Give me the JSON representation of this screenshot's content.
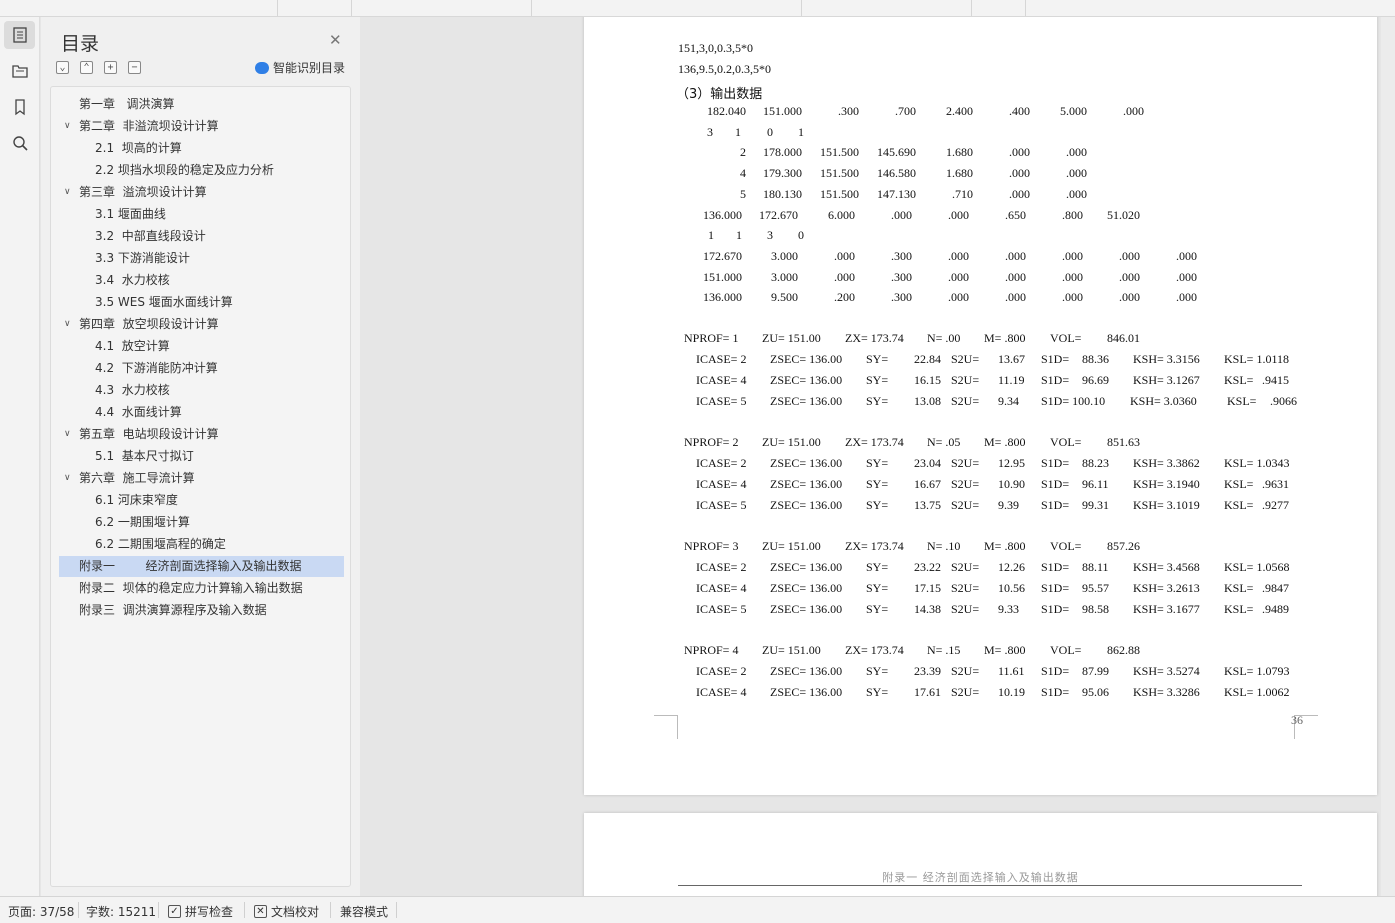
{
  "toc": {
    "title": "目录",
    "smart_label": "智能识别目录",
    "items": [
      {
        "label": "第一章   调洪演算",
        "level": 1,
        "expandable": false
      },
      {
        "label": "第二章  非溢流坝设计计算",
        "level": 1,
        "expandable": true
      },
      {
        "label": "2.1  坝高的计算",
        "level": 2,
        "expandable": false
      },
      {
        "label": "2.2 坝挡水坝段的稳定及应力分析",
        "level": 2,
        "expandable": false
      },
      {
        "label": "第三章  溢流坝设计计算",
        "level": 1,
        "expandable": true
      },
      {
        "label": "3.1 堰面曲线",
        "level": 2,
        "expandable": false
      },
      {
        "label": "3.2  中部直线段设计",
        "level": 2,
        "expandable": false
      },
      {
        "label": "3.3 下游消能设计",
        "level": 2,
        "expandable": false
      },
      {
        "label": "3.4  水力校核",
        "level": 2,
        "expandable": false
      },
      {
        "label": "3.5 WES 堰面水面线计算",
        "level": 2,
        "expandable": false
      },
      {
        "label": "第四章  放空坝段设计计算",
        "level": 1,
        "expandable": true
      },
      {
        "label": "4.1  放空计算",
        "level": 2,
        "expandable": false
      },
      {
        "label": "4.2  下游消能防冲计算",
        "level": 2,
        "expandable": false
      },
      {
        "label": "4.3  水力校核",
        "level": 2,
        "expandable": false
      },
      {
        "label": "4.4  水面线计算",
        "level": 2,
        "expandable": false
      },
      {
        "label": "第五章  电站坝段设计计算",
        "level": 1,
        "expandable": true
      },
      {
        "label": "5.1  基本尺寸拟订",
        "level": 2,
        "expandable": false
      },
      {
        "label": "第六章  施工导流计算",
        "level": 1,
        "expandable": true
      },
      {
        "label": "6.1 河床束窄度",
        "level": 2,
        "expandable": false
      },
      {
        "label": "6.2 一期围堰计算",
        "level": 2,
        "expandable": false
      },
      {
        "label": "6.2 二期围堰高程的确定",
        "level": 2,
        "expandable": false
      },
      {
        "label": "附录一        经济剖面选择输入及输出数据",
        "level": 1,
        "expandable": false,
        "selected": true
      },
      {
        "label": "附录二  坝体的稳定应力计算输入输出数据",
        "level": 1,
        "expandable": false
      },
      {
        "label": "附录三  调洪演算源程序及输入数据",
        "level": 1,
        "expandable": false
      }
    ]
  },
  "document": {
    "page1": {
      "input_lines": [
        "151,3,0,0.3,5*0",
        "136,9.5,0.2,0.3,5*0"
      ],
      "section_heading": "（3）输出数据",
      "rows_a": [
        [
          "182.040",
          "151.000",
          ".300",
          ".700",
          "2.400",
          ".400",
          "5.000",
          ".000"
        ],
        [
          "3",
          "1",
          "0",
          "1"
        ],
        [
          "2",
          "178.000",
          "151.500",
          "145.690",
          "1.680",
          ".000",
          ".000"
        ],
        [
          "4",
          "179.300",
          "151.500",
          "146.580",
          "1.680",
          ".000",
          ".000"
        ],
        [
          "5",
          "180.130",
          "151.500",
          "147.130",
          ".710",
          ".000",
          ".000"
        ],
        [
          "136.000",
          "172.670",
          "6.000",
          ".000",
          ".000",
          ".650",
          ".800",
          "51.020"
        ],
        [
          "1",
          "1",
          "3",
          "0"
        ],
        [
          "172.670",
          "3.000",
          ".000",
          ".300",
          ".000",
          ".000",
          ".000",
          ".000",
          ".000"
        ],
        [
          "151.000",
          "3.000",
          ".000",
          ".300",
          ".000",
          ".000",
          ".000",
          ".000",
          ".000"
        ],
        [
          "136.000",
          "9.500",
          ".200",
          ".300",
          ".000",
          ".000",
          ".000",
          ".000",
          ".000"
        ]
      ],
      "profiles": [
        {
          "header": [
            "NPROF= 1",
            "ZU= 151.00",
            "ZX= 173.74",
            "N= .00",
            "M= .800",
            "VOL=",
            "846.01"
          ],
          "cases": [
            [
              "ICASE= 2",
              "ZSEC= 136.00",
              "SY=",
              "22.84",
              "S2U=",
              "13.67",
              "S1D=",
              "88.36",
              "KSH= 3.3156",
              "KSL= 1.0118"
            ],
            [
              "ICASE= 4",
              "ZSEC= 136.00",
              "SY=",
              "16.15",
              "S2U=",
              "11.19",
              "S1D=",
              "96.69",
              "KSH= 3.1267",
              "KSL=",
              ".9415"
            ],
            [
              "ICASE= 5",
              "ZSEC= 136.00",
              "SY=",
              "13.08",
              "S2U=",
              "9.34",
              "S1D= 100.10",
              "",
              "KSH= 3.0360",
              "KSL=",
              ".9066"
            ]
          ]
        },
        {
          "header": [
            "NPROF= 2",
            "ZU= 151.00",
            "ZX= 173.74",
            "N= .05",
            "M= .800",
            "VOL=",
            "851.63"
          ],
          "cases": [
            [
              "ICASE= 2",
              "ZSEC= 136.00",
              "SY=",
              "23.04",
              "S2U=",
              "12.95",
              "S1D=",
              "88.23",
              "KSH= 3.3862",
              "KSL= 1.0343"
            ],
            [
              "ICASE= 4",
              "ZSEC= 136.00",
              "SY=",
              "16.67",
              "S2U=",
              "10.90",
              "S1D=",
              "96.11",
              "KSH= 3.1940",
              "KSL=",
              ".9631"
            ],
            [
              "ICASE= 5",
              "ZSEC= 136.00",
              "SY=",
              "13.75",
              "S2U=",
              "9.39",
              "S1D=",
              "99.31",
              "KSH= 3.1019",
              "KSL=",
              ".9277"
            ]
          ]
        },
        {
          "header": [
            "NPROF= 3",
            "ZU= 151.00",
            "ZX= 173.74",
            "N= .10",
            "M= .800",
            "VOL=",
            "857.26"
          ],
          "cases": [
            [
              "ICASE= 2",
              "ZSEC= 136.00",
              "SY=",
              "23.22",
              "S2U=",
              "12.26",
              "S1D=",
              "88.11",
              "KSH= 3.4568",
              "KSL= 1.0568"
            ],
            [
              "ICASE= 4",
              "ZSEC= 136.00",
              "SY=",
              "17.15",
              "S2U=",
              "10.56",
              "S1D=",
              "95.57",
              "KSH= 3.2613",
              "KSL=",
              ".9847"
            ],
            [
              "ICASE= 5",
              "ZSEC= 136.00",
              "SY=",
              "14.38",
              "S2U=",
              "9.33",
              "S1D=",
              "98.58",
              "KSH= 3.1677",
              "KSL=",
              ".9489"
            ]
          ]
        },
        {
          "header": [
            "NPROF= 4",
            "ZU= 151.00",
            "ZX= 173.74",
            "N= .15",
            "M= .800",
            "VOL=",
            "862.88"
          ],
          "cases": [
            [
              "ICASE= 2",
              "ZSEC= 136.00",
              "SY=",
              "23.39",
              "S2U=",
              "11.61",
              "S1D=",
              "87.99",
              "KSH= 3.5274",
              "KSL= 1.0793"
            ],
            [
              "ICASE= 4",
              "ZSEC= 136.00",
              "SY=",
              "17.61",
              "S2U=",
              "10.19",
              "S1D=",
              "95.06",
              "KSH= 3.3286",
              "KSL= 1.0062"
            ]
          ]
        }
      ],
      "page_number": "36"
    },
    "page2": {
      "header": "附录一        经济剖面选择输入及输出数据"
    }
  },
  "status": {
    "page": "页面: 37/58",
    "words": "字数: 15211",
    "spell_check": "拼写检查",
    "doc_proof": "文档校对",
    "compat_mode": "兼容模式"
  },
  "colors": {
    "selection": "#c9d9f3",
    "accent": "#2f7fe6"
  }
}
